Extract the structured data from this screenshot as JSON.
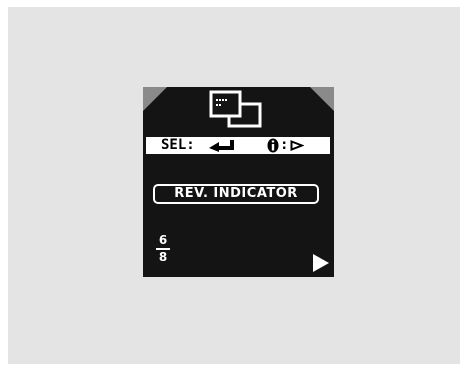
{
  "display": {
    "hint_bar": {
      "select_label": "SEL:",
      "select_icon": "enter-arrow-icon",
      "info_icon": "info-icon",
      "info_colon": ":",
      "info_action_icon": "play-outline-icon"
    },
    "header_icon": "windows-icon",
    "menu_item_label": "REV. INDICATOR",
    "page": {
      "current": "6",
      "total": "8"
    },
    "next_icon": "play-arrow-icon"
  },
  "colors": {
    "screen_background": "#141414",
    "foreground": "#ffffff",
    "corner_tab": "#8a8a8a",
    "backdrop": "#e4e4e4"
  }
}
